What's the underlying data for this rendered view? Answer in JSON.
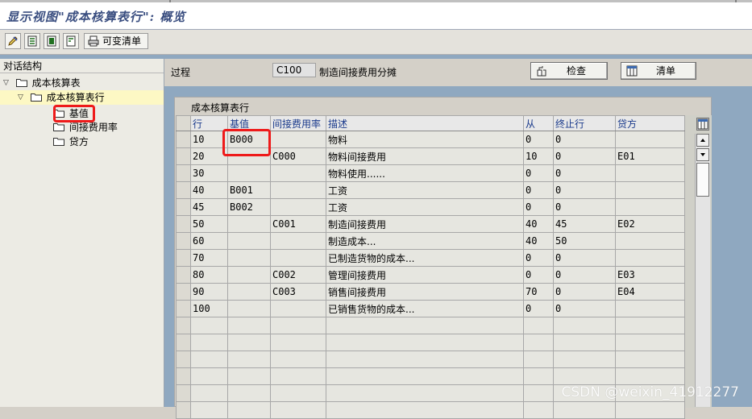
{
  "title": "显示视图\"成本核算表行\": 概览",
  "toolbar": {
    "icons": [
      "edit-icon",
      "select-all-icon",
      "deselect-icon",
      "select-block-icon"
    ],
    "print_label": "可变清单"
  },
  "left_panel": {
    "header": "对话结构",
    "tree": [
      {
        "label": "成本核算表",
        "level": 0,
        "expanded": true
      },
      {
        "label": "成本核算表行",
        "level": 1,
        "expanded": true,
        "selected": true
      },
      {
        "label": "基值",
        "level": 2
      },
      {
        "label": "间接费用率",
        "level": 2
      },
      {
        "label": "贷方",
        "level": 2
      }
    ]
  },
  "header_fields": {
    "process_label": "过程",
    "process_value": "C100",
    "process_desc": "制造间接费用分摊",
    "check_button": "检查",
    "list_button": "清单"
  },
  "table": {
    "group_title": "成本核算表行",
    "columns": [
      "行",
      "基值",
      "间接费用率",
      "描述",
      "从",
      "终止行",
      "贷方"
    ],
    "rows": [
      [
        "10",
        "B000",
        "",
        "物料",
        "0",
        "0",
        ""
      ],
      [
        "20",
        "",
        "C000",
        "物料间接费用",
        "10",
        "0",
        "E01"
      ],
      [
        "30",
        "",
        "",
        "物料使用......",
        "0",
        "0",
        ""
      ],
      [
        "40",
        "B001",
        "",
        "工资",
        "0",
        "0",
        ""
      ],
      [
        "45",
        "B002",
        "",
        "工资",
        "0",
        "0",
        ""
      ],
      [
        "50",
        "",
        "C001",
        "制造间接费用",
        "40",
        "45",
        "E02"
      ],
      [
        "60",
        "",
        "",
        "制造成本...",
        "40",
        "50",
        ""
      ],
      [
        "70",
        "",
        "",
        "已制造货物的成本...",
        "0",
        "0",
        ""
      ],
      [
        "80",
        "",
        "C002",
        "管理间接费用",
        "0",
        "0",
        "E03"
      ],
      [
        "90",
        "",
        "C003",
        "销售间接费用",
        "70",
        "0",
        "E04"
      ],
      [
        "100",
        "",
        "",
        "已销售货物的成本...",
        "0",
        "0",
        ""
      ]
    ],
    "empty_rows": 6
  },
  "watermark": "CSDN @weixin_41912277",
  "colors": {
    "title_blue": "#3a4e80",
    "header_blue": "#1a3a8c",
    "highlight_red": "#ee1a1a",
    "background_blue": "#8fa8c0"
  }
}
